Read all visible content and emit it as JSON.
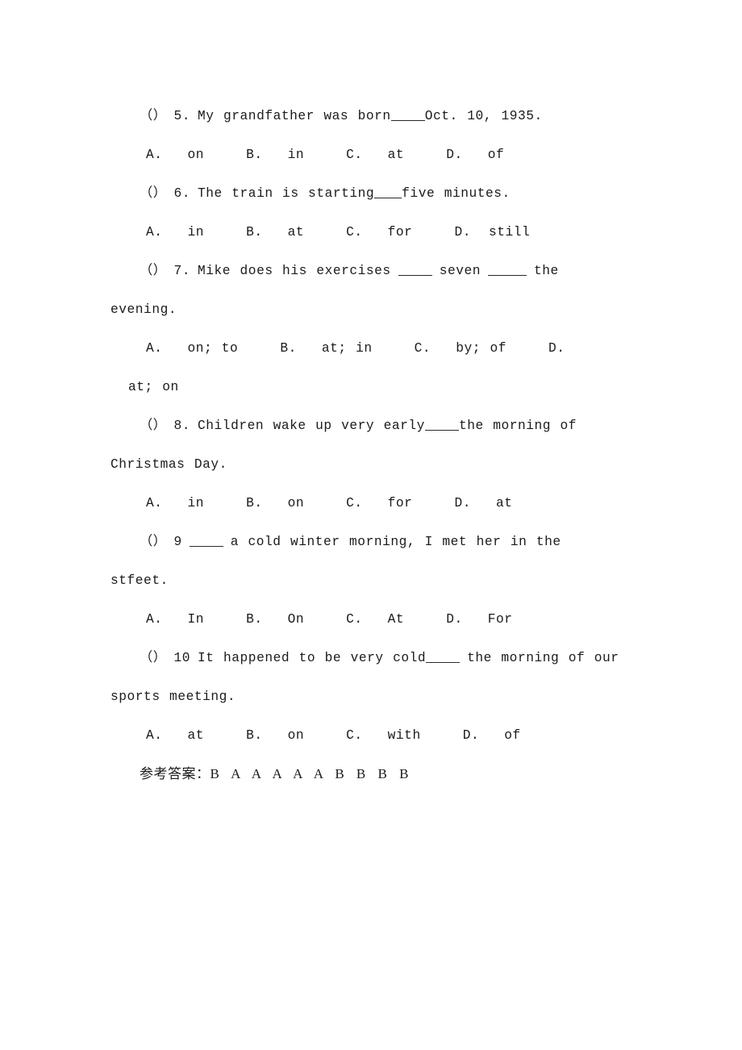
{
  "document": {
    "background_color": "#ffffff",
    "text_color": "#1b1b1b"
  },
  "exercise": {
    "questions": [
      {
        "marker": "（）",
        "number": "5.",
        "text_before": "My grandfather was born",
        "blank": "____",
        "text_after": "Oct. 10, 1935.",
        "full_text": "（）5. My grandfather was born____Oct. 10, 1935.",
        "options": [
          {
            "letter": "A.",
            "value": "on"
          },
          {
            "letter": "B.",
            "value": "in"
          },
          {
            "letter": "C.",
            "value": "at"
          },
          {
            "letter": "D.",
            "value": "of"
          }
        ],
        "options_text": "A. on      B. in     C. at      D. of"
      },
      {
        "marker": "（）",
        "number": "6.",
        "text_before": "The train is starting",
        "blank": "___",
        "text_after": "five minutes.",
        "full_text": "（）6. The train is starting___five minutes.",
        "options": [
          {
            "letter": "A.",
            "value": "in"
          },
          {
            "letter": "B.",
            "value": "at"
          },
          {
            "letter": "C.",
            "value": "for"
          },
          {
            "letter": "D.",
            "value": "still"
          }
        ],
        "options_text": "A. in     B. at     C. for     D.still"
      },
      {
        "marker": "（）",
        "number": "7.",
        "text_before": "Mike does his exercises",
        "blank": "____",
        "text_middle": "seven",
        "blank2": "_____",
        "text_after": "the evening.",
        "full_text": "（）7. Mike does his exercises ____ seven _____ the evening.",
        "options": [
          {
            "letter": "A.",
            "value": "on; to"
          },
          {
            "letter": "B.",
            "value": "at; in"
          },
          {
            "letter": "C.",
            "value": "by; of"
          },
          {
            "letter": "D.",
            "value": "at; on"
          }
        ],
        "options_text": "A. on; to     B. at; in     C. by; of     D. at; on"
      },
      {
        "marker": "（）",
        "number": "8.",
        "text_before": "Children wake up very early",
        "blank": "____",
        "text_after": "the morning of Christmas Day.",
        "full_text": "（）8. Children wake up very early____the morning of Christmas Day.",
        "options": [
          {
            "letter": "A.",
            "value": "in"
          },
          {
            "letter": "B.",
            "value": "on"
          },
          {
            "letter": "C.",
            "value": "for"
          },
          {
            "letter": "D.",
            "value": "at"
          }
        ],
        "options_text": "A. in     B. on     C. for     D. at"
      },
      {
        "marker": "（）",
        "number": "9",
        "text_before": "",
        "blank": "____",
        "text_after": "a cold winter morning, I met her in the stfeet.",
        "full_text": "（）9 ____ a cold winter morning, I met her in the stfeet.",
        "options": [
          {
            "letter": "A.",
            "value": "In"
          },
          {
            "letter": "B.",
            "value": "On"
          },
          {
            "letter": "C.",
            "value": "At"
          },
          {
            "letter": "D.",
            "value": "For"
          }
        ],
        "options_text": "A. In     B. On     C. At     D. For"
      },
      {
        "marker": "（）",
        "number": "10",
        "text_before": "It happened to be very cold",
        "blank": "____",
        "text_after": "the morning of our sports meeting.",
        "full_text": "（）10 It happened to be very cold____ the morning of our sports meeting.",
        "options": [
          {
            "letter": "A.",
            "value": "at"
          },
          {
            "letter": "B.",
            "value": "on"
          },
          {
            "letter": "C.",
            "value": "with"
          },
          {
            "letter": "D.",
            "value": "of"
          }
        ],
        "options_text": "A. at     B. on     C. with     D. of"
      }
    ],
    "answer_key": {
      "label": "参考答案：",
      "answers": "B A A A A A B B B B"
    }
  }
}
